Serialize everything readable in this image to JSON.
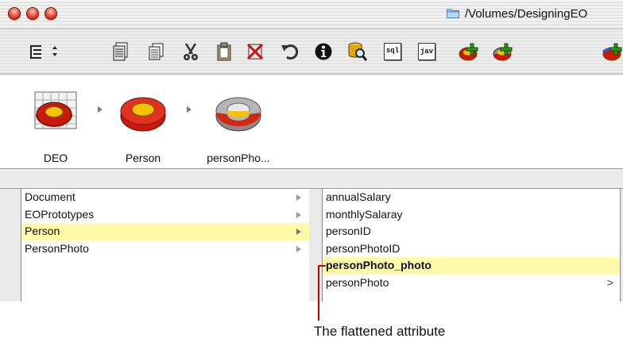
{
  "window": {
    "title": "/Volumes/DesigningEO"
  },
  "toolbar": {
    "buttons": [
      {
        "name": "view-mode-popup",
        "icon": "list-view-icon"
      },
      {
        "name": "new-entity",
        "icon": "new-document-icon"
      },
      {
        "name": "copy",
        "icon": "copy-icon"
      },
      {
        "name": "cut",
        "icon": "scissors-icon"
      },
      {
        "name": "paste",
        "icon": "clipboard-icon"
      },
      {
        "name": "delete",
        "icon": "delete-icon"
      },
      {
        "name": "undo",
        "icon": "undo-icon"
      },
      {
        "name": "inspector",
        "icon": "info-icon"
      },
      {
        "name": "browse-data",
        "icon": "database-search-icon"
      },
      {
        "name": "generate-sql",
        "icon": "sql-icon"
      },
      {
        "name": "generate-java",
        "icon": "java-icon"
      },
      {
        "name": "add-entity",
        "icon": "add-entity-icon"
      },
      {
        "name": "add-attribute",
        "icon": "add-attribute-icon"
      },
      {
        "name": "add-relationship",
        "icon": "add-relationship-icon"
      }
    ],
    "sql_label": "sql",
    "java_label": "jav"
  },
  "path": {
    "items": [
      {
        "label": "DEO",
        "icon": "model-icon"
      },
      {
        "label": "Person",
        "icon": "entity-icon"
      },
      {
        "label": "personPho...",
        "icon": "relationship-icon"
      }
    ]
  },
  "left_column": {
    "items": [
      {
        "label": "Document",
        "selected": false
      },
      {
        "label": "EOPrototypes",
        "selected": false
      },
      {
        "label": "Person",
        "selected": true
      },
      {
        "label": "PersonPhoto",
        "selected": false
      }
    ]
  },
  "right_column": {
    "items": [
      {
        "label": "annualSalary"
      },
      {
        "label": "monthlySalaray"
      },
      {
        "label": "personID"
      },
      {
        "label": "personPhotoID"
      },
      {
        "label": "personPhoto_photo"
      },
      {
        "label": "personPhoto"
      }
    ],
    "chevron": ">"
  },
  "callout": {
    "text": "The flattened attribute"
  },
  "colors": {
    "selection": "#fffaaa",
    "callout": "#c00000"
  }
}
